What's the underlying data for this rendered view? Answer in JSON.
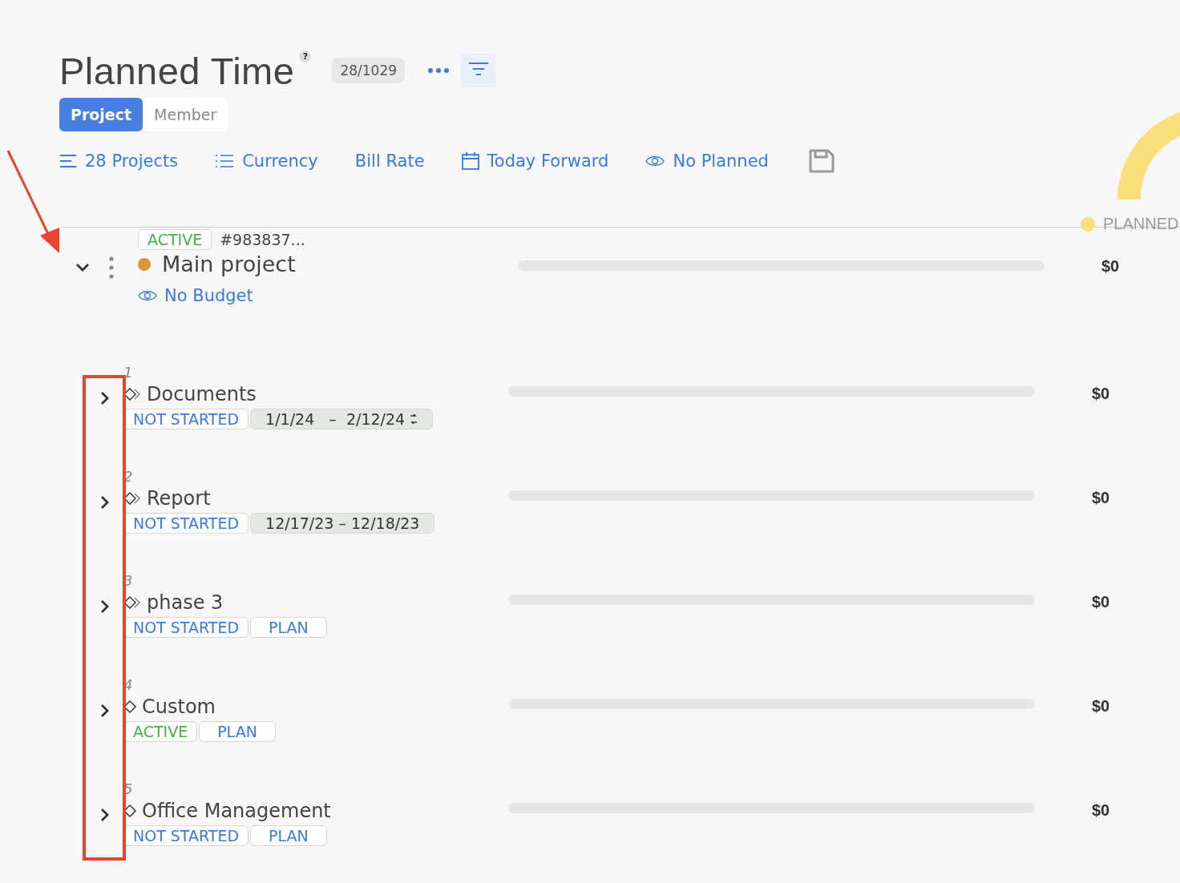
{
  "header": {
    "title": "Planned Time",
    "help": "?",
    "count": "28/1029"
  },
  "tabs": [
    {
      "label": "Project",
      "selected": true
    },
    {
      "label": "Member",
      "selected": false
    }
  ],
  "toolbar": [
    {
      "kind": "lines",
      "label": "28 Projects"
    },
    {
      "kind": "list",
      "label": "Currency"
    },
    {
      "kind": "plain",
      "label": "Bill Rate"
    },
    {
      "kind": "calendar",
      "label": "Today Forward"
    },
    {
      "kind": "eye",
      "label": "No Planned"
    },
    {
      "kind": "save"
    }
  ],
  "chart_legend": {
    "label": "PLANNED",
    "color": "#fbdf7c"
  },
  "project": {
    "expanded": true,
    "status": {
      "kind": "active",
      "label": "ACTIVE"
    },
    "id": "#983837...",
    "color": "#e0953a",
    "name": "Main project",
    "budget": "No Budget",
    "level": 0,
    "amount": "$0"
  },
  "phases": [
    {
      "number": "1",
      "name": "Documents",
      "kind": "double",
      "expanded": false,
      "tags": [
        {
          "kind": "not_started",
          "label": "NOT STARTED"
        },
        {
          "kind": "dates",
          "label": "1/1/24   –  2/12/24",
          "repeat": true
        }
      ],
      "level": 0,
      "amount": "$0"
    },
    {
      "number": "2",
      "name": "Report",
      "kind": "double",
      "expanded": false,
      "tags": [
        {
          "kind": "not_started",
          "label": "NOT STARTED"
        },
        {
          "kind": "dates",
          "label": "12/17/23 – 12/18/23",
          "repeat": false
        }
      ],
      "level": 0,
      "amount": "$0"
    },
    {
      "number": "3",
      "name": "phase 3",
      "kind": "double",
      "expanded": false,
      "tags": [
        {
          "kind": "not_started",
          "label": "NOT STARTED"
        },
        {
          "kind": "plan",
          "label": "PLAN"
        }
      ],
      "level": 0,
      "amount": "$0"
    },
    {
      "number": "4",
      "name": "Custom",
      "kind": "single",
      "expanded": false,
      "tags": [
        {
          "kind": "active",
          "label": "ACTIVE"
        },
        {
          "kind": "plan",
          "label": "PLAN"
        }
      ],
      "level": 0,
      "amount": "$0"
    },
    {
      "number": "5",
      "name": "Office Management",
      "kind": "single",
      "expanded": false,
      "tags": [
        {
          "kind": "not_started",
          "label": "NOT STARTED"
        },
        {
          "kind": "plan",
          "label": "PLAN"
        }
      ],
      "level": 0,
      "amount": "$0"
    }
  ]
}
